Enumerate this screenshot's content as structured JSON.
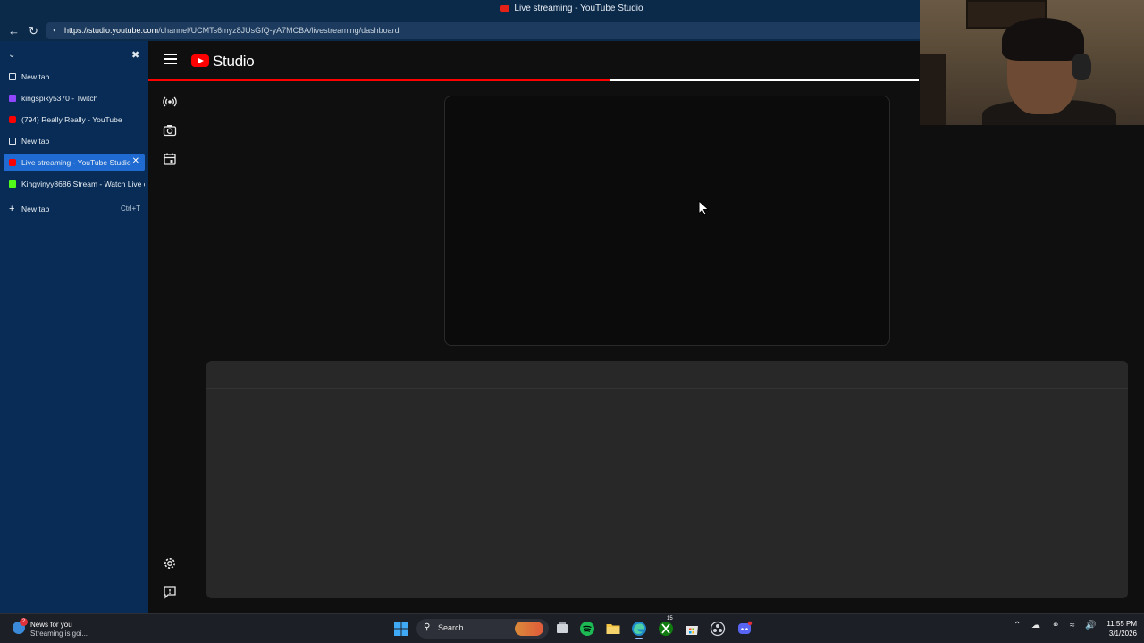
{
  "window": {
    "title": "Live streaming - YouTube Studio",
    "url_host": "https://studio.youtube.com",
    "url_path": "/channel/UCMTs6myz8JUsGfQ-yA7MCBA/livestreaming/dashboard"
  },
  "tabs": [
    {
      "label": "New tab",
      "icon": "newtab-icon",
      "active": false
    },
    {
      "label": "kingspiky5370 - Twitch",
      "icon": "twitch-icon",
      "active": false
    },
    {
      "label": "(794) Really Really - YouTube",
      "icon": "youtube-icon",
      "active": false
    },
    {
      "label": "New tab",
      "icon": "newtab-icon",
      "active": false
    },
    {
      "label": "Live streaming - YouTube Studio",
      "icon": "youtube-icon",
      "active": true
    },
    {
      "label": "Kingvinyy8686 Stream - Watch Live o",
      "icon": "kick-icon",
      "active": false
    }
  ],
  "new_tab": {
    "label": "New tab",
    "shortcut": "Ctrl+T"
  },
  "studio": {
    "logo_text": "Studio",
    "progress_fraction": 0.6
  },
  "taskbar": {
    "news_title": "News for you",
    "news_sub": "Streaming is goi...",
    "news_badge": "2",
    "search_label": "Search",
    "time": "11:55 PM",
    "date": "3/1/2026",
    "xbox_badge": "15"
  },
  "colors": {
    "chrome_bg": "#0b2a4a",
    "sidebar_bg": "#082c55",
    "active_tab": "#1f6bd1",
    "studio_bg": "#0f0f0f",
    "panel_bg": "#282828",
    "accent_red": "#ff0000"
  }
}
